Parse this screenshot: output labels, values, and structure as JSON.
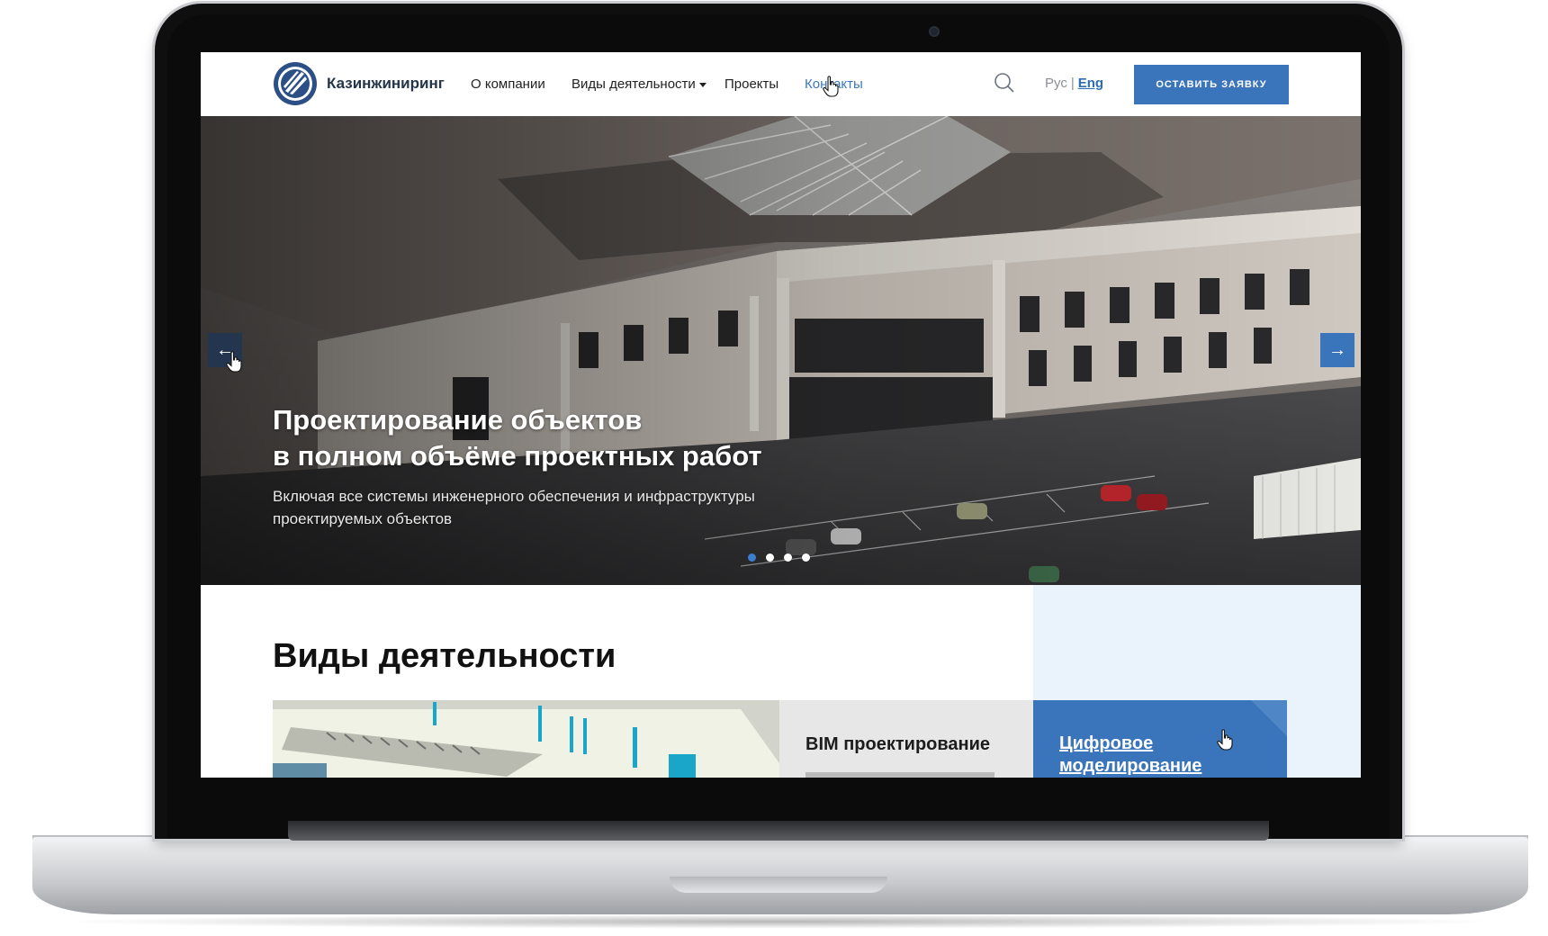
{
  "header": {
    "brand": "Казинжиниринг",
    "nav": [
      {
        "label": "О компании"
      },
      {
        "label": "Виды деятельности"
      },
      {
        "label": "Проекты"
      },
      {
        "label": "Контакты"
      }
    ],
    "lang_ru": "Рус",
    "lang_sep": "|",
    "lang_en": "Eng",
    "cta": "ОСТАВИТЬ ЗАЯВКУ",
    "icons": {
      "logo": "company-logo",
      "search": "search-icon",
      "caret": "chevron-down-icon"
    }
  },
  "hero": {
    "title_line1": "Проектирование объектов",
    "title_line2": "в полном объёме проектных работ",
    "subtitle_line1": "Включая все системы инженерного обеспечения и инфраструктуры",
    "subtitle_line2": "проектируемых объектов",
    "prev_icon": "arrow-left-icon",
    "next_icon": "arrow-right-icon",
    "prev_glyph": "←",
    "next_glyph": "→",
    "slides_count": 4,
    "active_slide": 1
  },
  "activities": {
    "title": "Виды деятельности",
    "cards": [
      {
        "title": "BIM проектирование"
      },
      {
        "title_line1": "Цифровое",
        "title_line2": "моделирование"
      }
    ]
  },
  "colors": {
    "accent": "#3a74bb",
    "dark_nav": "#24364f",
    "active_link": "#3a79bd"
  }
}
